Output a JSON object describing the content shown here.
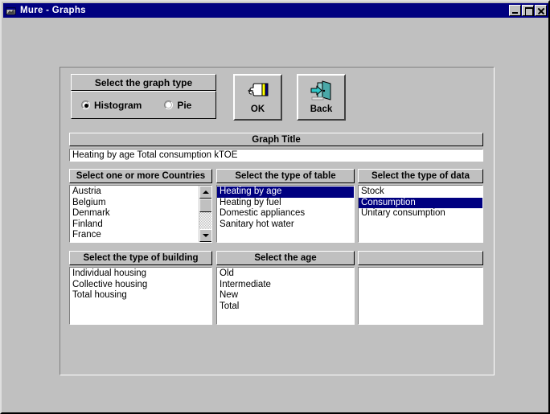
{
  "window": {
    "title": "Mure - Graphs",
    "icon": "app-window-icon",
    "controls": {
      "minimize": "minimize-button",
      "maximize": "maximize-button",
      "close": "close-button"
    }
  },
  "graph_type": {
    "header": "Select the graph type",
    "options": [
      {
        "label": "Histogram",
        "selected": true
      },
      {
        "label": "Pie",
        "selected": false
      }
    ]
  },
  "buttons": {
    "ok": {
      "label": "OK",
      "icon": "pointing-hand-icon"
    },
    "back": {
      "label": "Back",
      "icon": "exit-door-icon"
    }
  },
  "graph_title": {
    "header": "Graph Title",
    "value": "Heating by age Total consumption kTOE",
    "placeholder": ""
  },
  "lists": {
    "countries": {
      "header": "Select one or more Countries",
      "items": [
        {
          "label": "Austria",
          "selected": false
        },
        {
          "label": "Belgium",
          "selected": false
        },
        {
          "label": "Denmark",
          "selected": false
        },
        {
          "label": "Finland",
          "selected": false
        },
        {
          "label": "France",
          "selected": false
        }
      ],
      "has_scrollbar": true
    },
    "table_type": {
      "header": "Select the type of table",
      "items": [
        {
          "label": "Heating by age",
          "selected": true
        },
        {
          "label": "Heating by fuel",
          "selected": false
        },
        {
          "label": "Domestic appliances",
          "selected": false
        },
        {
          "label": "Sanitary hot water",
          "selected": false
        }
      ],
      "has_scrollbar": false
    },
    "data_type": {
      "header": "Select the type of data",
      "items": [
        {
          "label": "Stock",
          "selected": false
        },
        {
          "label": "Consumption",
          "selected": true
        },
        {
          "label": "Unitary consumption",
          "selected": false
        }
      ],
      "has_scrollbar": false
    },
    "building_type": {
      "header": "Select the type of building",
      "items": [
        {
          "label": "Individual housing",
          "selected": false
        },
        {
          "label": "Collective housing",
          "selected": false
        },
        {
          "label": "Total housing",
          "selected": false
        }
      ],
      "has_scrollbar": false
    },
    "age": {
      "header": "Select the age",
      "items": [
        {
          "label": "Old",
          "selected": false
        },
        {
          "label": "Intermediate",
          "selected": false
        },
        {
          "label": "New",
          "selected": false
        },
        {
          "label": "Total",
          "selected": false
        }
      ],
      "has_scrollbar": false
    },
    "empty": {
      "header": "",
      "items": [],
      "has_scrollbar": false
    }
  },
  "colors": {
    "titlebar": "#000080",
    "face": "#c0c0c0",
    "selection": "#000080",
    "selection_text": "#ffffff",
    "list_bg": "#ffffff"
  }
}
